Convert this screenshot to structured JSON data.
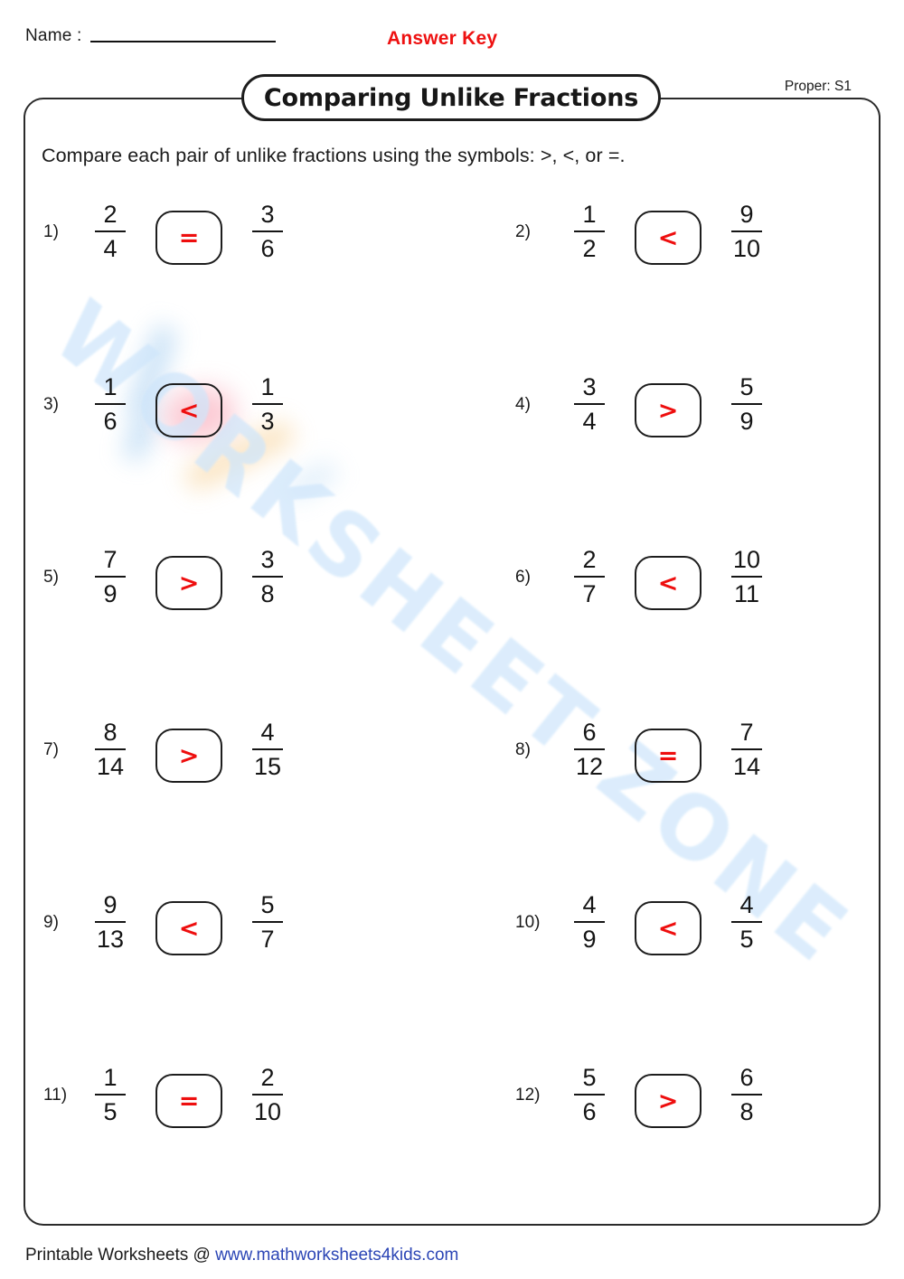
{
  "header": {
    "name_label": "Name :",
    "answer_key": "Answer Key",
    "proper_tag": "Proper: S1",
    "title": "Comparing Unlike Fractions"
  },
  "instruction": "Compare each pair of unlike fractions using the symbols: >, <, or =.",
  "watermark": {
    "text": "WORKSHEET ZONE",
    "color": "#cfe6fb"
  },
  "colors": {
    "answer_red": "#ee0e0e",
    "answer_key_red": "#ee1111",
    "link_blue": "#2b45b5",
    "ink": "#1a1a1a"
  },
  "problems": [
    {
      "number": "1)",
      "left_num": "2",
      "left_den": "4",
      "answer": "=",
      "right_num": "3",
      "right_den": "6"
    },
    {
      "number": "2)",
      "left_num": "1",
      "left_den": "2",
      "answer": "<",
      "right_num": "9",
      "right_den": "10"
    },
    {
      "number": "3)",
      "left_num": "1",
      "left_den": "6",
      "answer": "<",
      "right_num": "1",
      "right_den": "3"
    },
    {
      "number": "4)",
      "left_num": "3",
      "left_den": "4",
      "answer": ">",
      "right_num": "5",
      "right_den": "9"
    },
    {
      "number": "5)",
      "left_num": "7",
      "left_den": "9",
      "answer": ">",
      "right_num": "3",
      "right_den": "8"
    },
    {
      "number": "6)",
      "left_num": "2",
      "left_den": "7",
      "answer": "<",
      "right_num": "10",
      "right_den": "11"
    },
    {
      "number": "7)",
      "left_num": "8",
      "left_den": "14",
      "answer": ">",
      "right_num": "4",
      "right_den": "15"
    },
    {
      "number": "8)",
      "left_num": "6",
      "left_den": "12",
      "answer": "=",
      "right_num": "7",
      "right_den": "14"
    },
    {
      "number": "9)",
      "left_num": "9",
      "left_den": "13",
      "answer": "<",
      "right_num": "5",
      "right_den": "7"
    },
    {
      "number": "10)",
      "left_num": "4",
      "left_den": "9",
      "answer": "<",
      "right_num": "4",
      "right_den": "5"
    },
    {
      "number": "11)",
      "left_num": "1",
      "left_den": "5",
      "answer": "=",
      "right_num": "2",
      "right_den": "10"
    },
    {
      "number": "12)",
      "left_num": "5",
      "left_den": "6",
      "answer": ">",
      "right_num": "6",
      "right_den": "8"
    }
  ],
  "footer": {
    "prefix": "Printable Worksheets @ ",
    "url": "www.mathworksheets4kids.com"
  }
}
